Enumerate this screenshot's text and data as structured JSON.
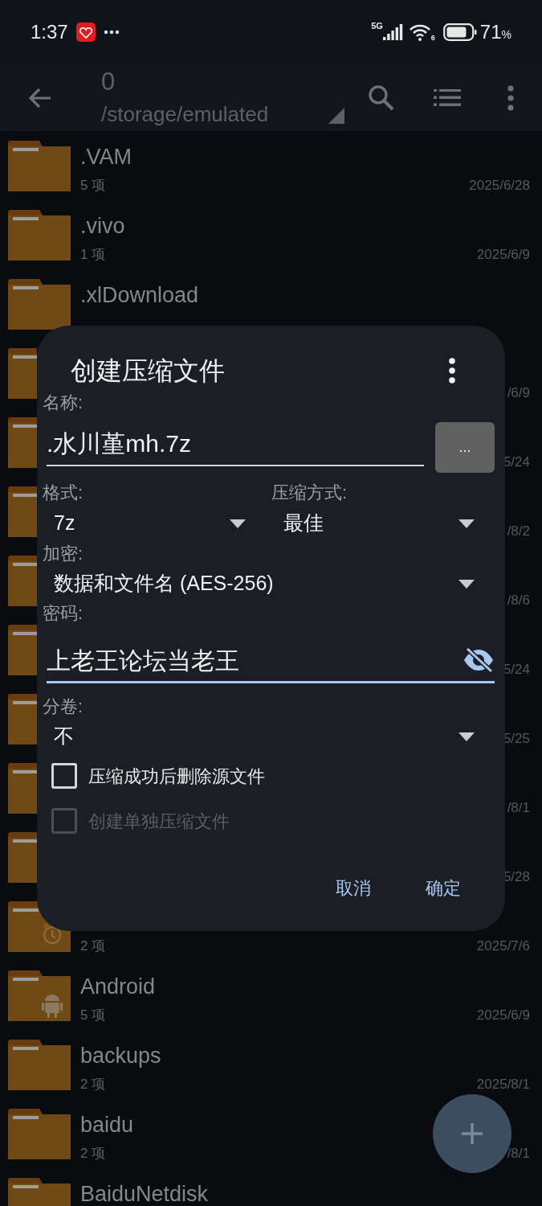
{
  "status_bar": {
    "time": "1:37",
    "network": "5G",
    "wifi_badge": "6",
    "battery": "71",
    "battery_unit": "%"
  },
  "app_bar": {
    "title": "0",
    "path": "/storage/emulated"
  },
  "files": [
    {
      "kind": "plain",
      "name": ".VAM",
      "count": "5 项",
      "date": "2025/6/28"
    },
    {
      "kind": "plain",
      "name": ".vivo",
      "count": "1 项",
      "date": "2025/6/9"
    },
    {
      "kind": "plain",
      "name": ".xlDownload"
    },
    {
      "kind": "covered",
      "date": "/6/9"
    },
    {
      "kind": "covered",
      "date": "5/24"
    },
    {
      "kind": "covered",
      "date": "/8/2"
    },
    {
      "kind": "covered",
      "date": "/8/6"
    },
    {
      "kind": "covered",
      "date": "5/24"
    },
    {
      "kind": "covered",
      "date": "5/25"
    },
    {
      "kind": "covered",
      "date": "/8/1"
    },
    {
      "kind": "covered",
      "date": "5/28"
    },
    {
      "kind": "clock",
      "count": "2 项",
      "date": "2025/7/6"
    },
    {
      "kind": "android",
      "name": "Android",
      "count": "5 项",
      "date": "2025/6/9"
    },
    {
      "kind": "plain",
      "name": "backups",
      "count": "2 项",
      "date": "2025/8/1"
    },
    {
      "kind": "plain",
      "name": "baidu",
      "count": "2 项",
      "date": "/8/1"
    },
    {
      "kind": "plain",
      "name": "BaiduNetdisk"
    }
  ],
  "dialog": {
    "title": "创建压缩文件",
    "name_label": "名称:",
    "name_value": ".水川堇mh.7z",
    "more_button": "...",
    "format_label": "格式:",
    "format_value": "7z",
    "method_label": "压缩方式:",
    "method_value": "最佳",
    "encryption_label": "加密:",
    "encryption_value": "数据和文件名 (AES-256)",
    "password_label": "密码:",
    "password_value": "上老王论坛当老王",
    "split_label": "分卷:",
    "split_value": "不",
    "options": [
      {
        "label": "压缩成功后删除源文件",
        "checked": false,
        "disabled": false
      },
      {
        "label": "创建单独压缩文件",
        "checked": false,
        "disabled": true
      }
    ],
    "buttons": [
      "取消",
      "确定"
    ]
  }
}
